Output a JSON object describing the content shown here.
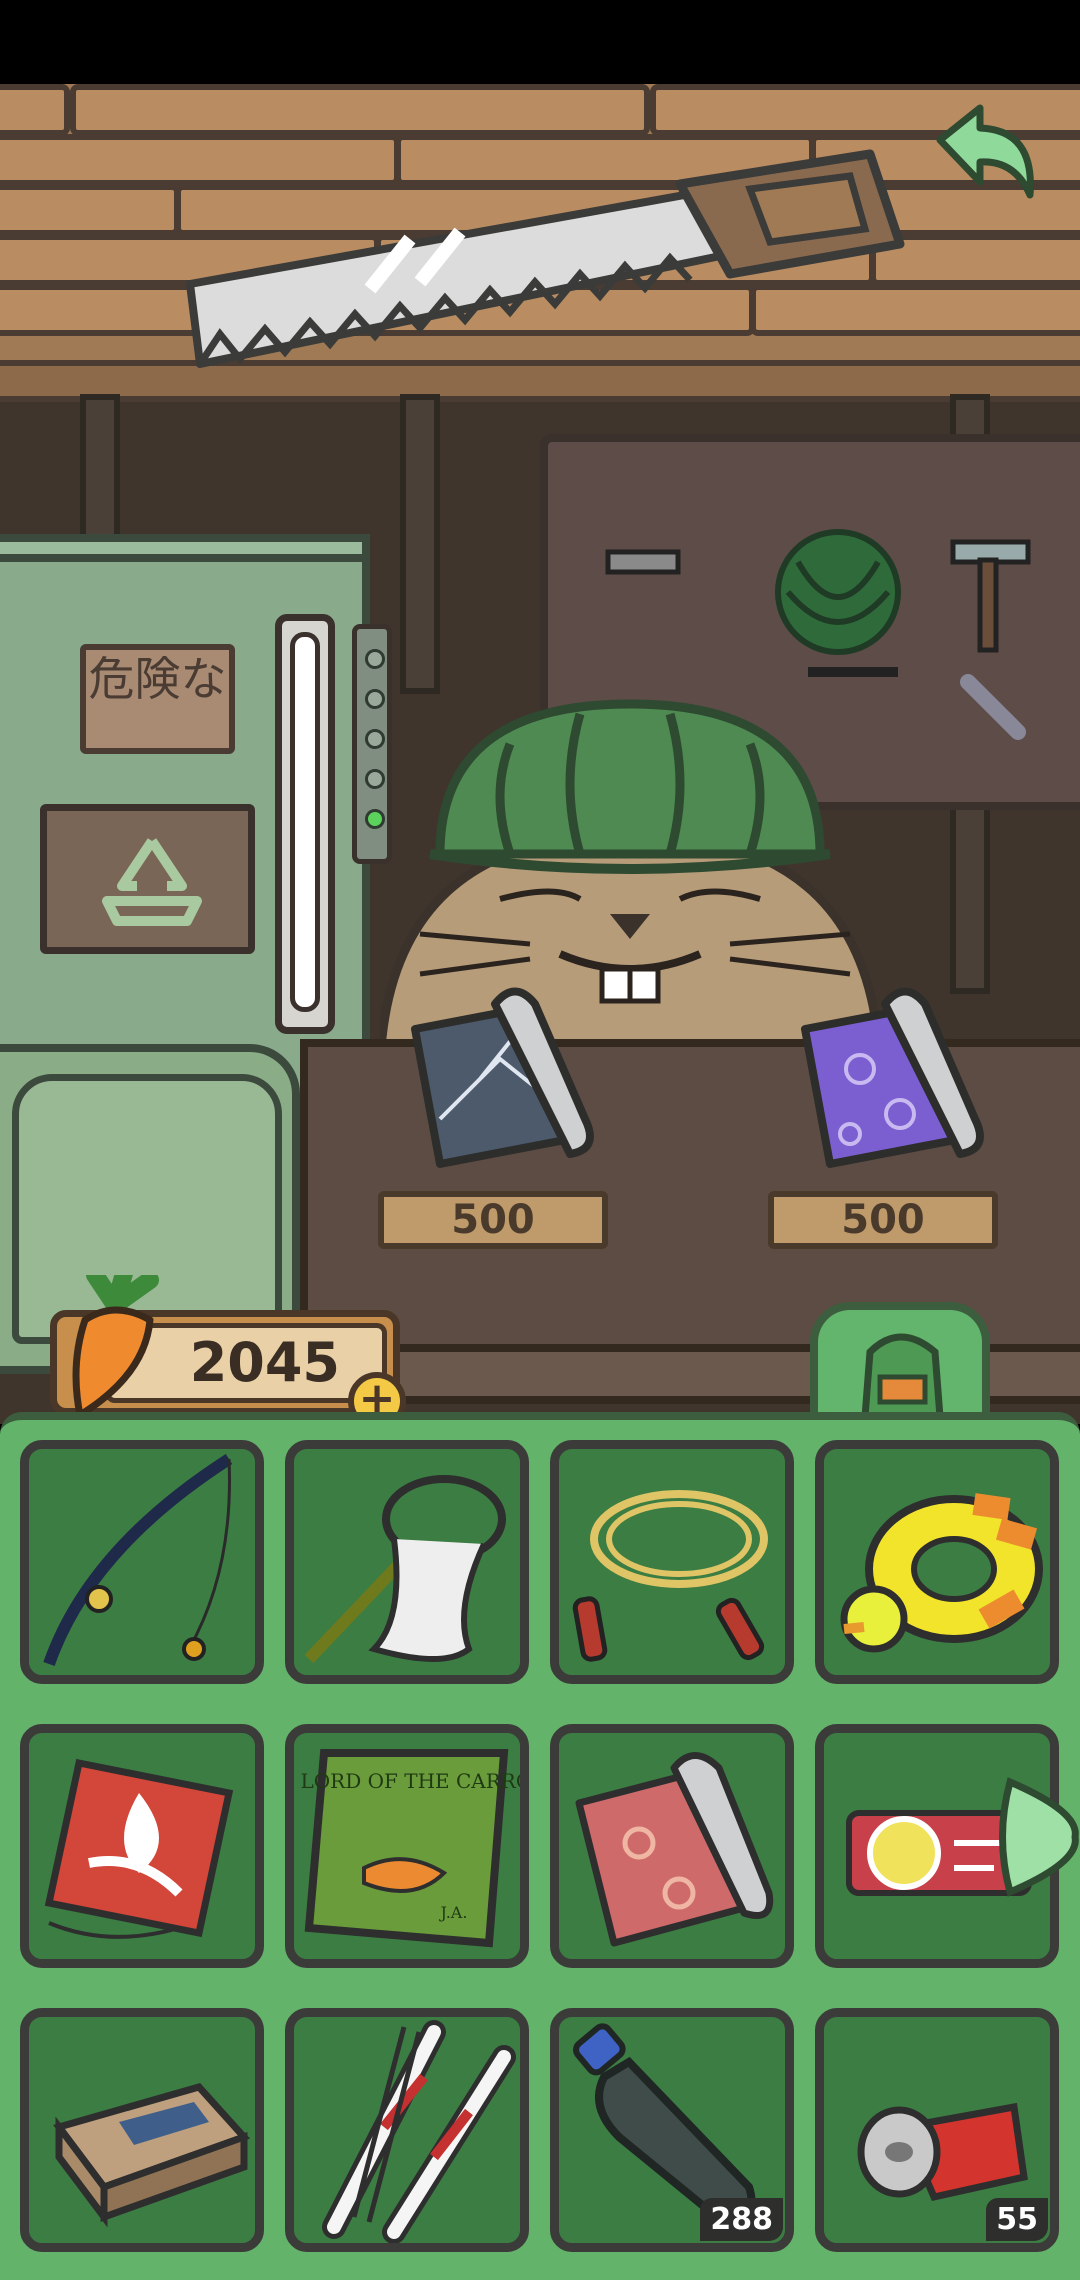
{
  "shop": {
    "items": [
      {
        "icon": "dark-blue-fabric-roll-icon",
        "price": "500"
      },
      {
        "icon": "purple-flower-fabric-roll-icon",
        "price": "500"
      }
    ]
  },
  "machine": {
    "sign_text": "危険な"
  },
  "currency": {
    "icon": "carrot-icon",
    "carrots": "2045"
  },
  "inventory": {
    "slots": [
      {
        "icon": "fishing-rod-icon",
        "count": ""
      },
      {
        "icon": "bug-net-icon",
        "count": ""
      },
      {
        "icon": "jump-rope-icon",
        "count": ""
      },
      {
        "icon": "duck-swim-ring-icon",
        "count": ""
      },
      {
        "icon": "red-kite-icon",
        "count": ""
      },
      {
        "icon": "lord-of-the-carrots-book-icon",
        "count": "",
        "book_title": "THE LORD OF THE CARROTS",
        "book_author": "J.A."
      },
      {
        "icon": "pink-fabric-roll-icon",
        "count": ""
      },
      {
        "icon": "ticket-card-icon",
        "count": ""
      },
      {
        "icon": "matchbox-icon",
        "count": ""
      },
      {
        "icon": "skis-icon",
        "count": ""
      },
      {
        "icon": "plastic-bottle-icon",
        "count": "288"
      },
      {
        "icon": "crushed-can-icon",
        "count": "55"
      }
    ]
  },
  "colors": {
    "inventory_bg": "#64b36a",
    "slot_bg": "#3c7d43",
    "brick": "#b98c62",
    "counter": "#5c4c43"
  }
}
